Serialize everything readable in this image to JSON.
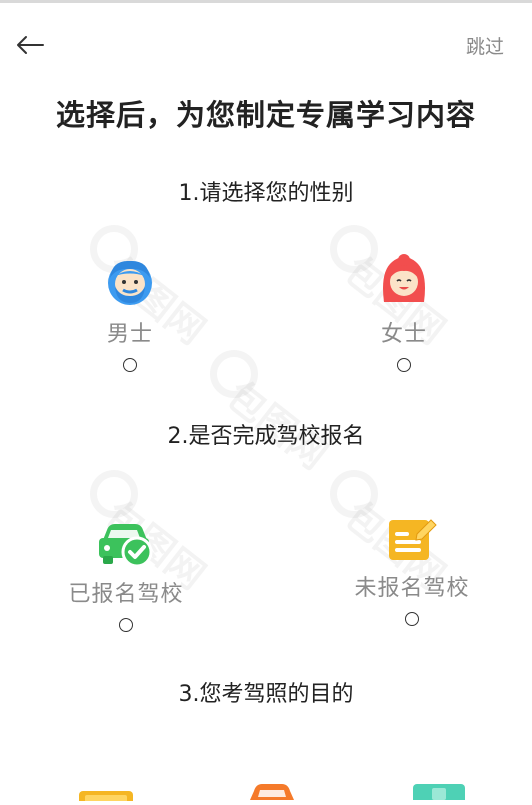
{
  "header": {
    "skip_label": "跳过"
  },
  "title": "选择后，为您制定专属学习内容",
  "questions": [
    {
      "label": "1.请选择您的性别",
      "options": [
        {
          "label": "男士"
        },
        {
          "label": "女士"
        }
      ]
    },
    {
      "label": "2.是否完成驾校报名",
      "options": [
        {
          "label": "已报名驾校"
        },
        {
          "label": "未报名驾校"
        }
      ]
    },
    {
      "label": "3.您考驾照的目的",
      "options": []
    }
  ],
  "watermark": "包图网",
  "colors": {
    "male": "#3d9bf0",
    "female": "#f24e4e",
    "car": "#3cc25c",
    "form": "#f5b623",
    "label": "#8a8a8a"
  }
}
